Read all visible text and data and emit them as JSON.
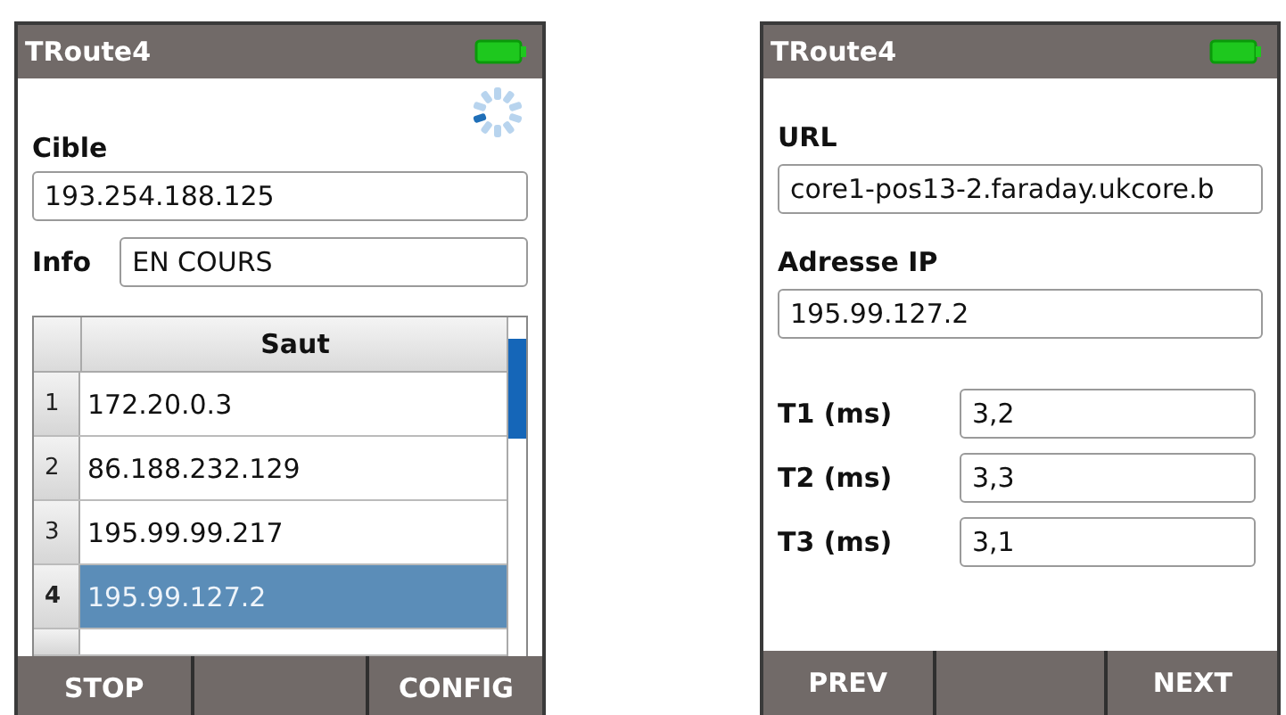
{
  "screens": [
    {
      "title": "TRoute4",
      "busy": true,
      "kind": "trace",
      "target": {
        "label": "Cible",
        "value": "193.254.188.125"
      },
      "info": {
        "label": "Info",
        "value": "EN COURS"
      },
      "table": {
        "columns": [
          "Saut"
        ],
        "rows": [
          {
            "index": "1",
            "hop": "172.20.0.3",
            "selected": false
          },
          {
            "index": "2",
            "hop": "86.188.232.129",
            "selected": false
          },
          {
            "index": "3",
            "hop": "195.99.99.217",
            "selected": false
          },
          {
            "index": "4",
            "hop": "195.99.127.2",
            "selected": true
          }
        ]
      },
      "softkeys": [
        {
          "kind": "label",
          "label": "STOP"
        },
        {
          "kind": "empty"
        },
        {
          "kind": "label",
          "label": "CONFIG"
        }
      ]
    },
    {
      "title": "TRoute4",
      "busy": false,
      "kind": "detail",
      "url": {
        "label": "URL",
        "value": "core1-pos13-2.faraday.ukcore.b"
      },
      "ip": {
        "label": "Adresse IP",
        "value": "195.99.127.2"
      },
      "times": [
        {
          "label": "T1 (ms)",
          "value": "3,2"
        },
        {
          "label": "T2 (ms)",
          "value": "3,3"
        },
        {
          "label": "T3 (ms)",
          "value": "3,1"
        }
      ],
      "softkeys": [
        {
          "kind": "label",
          "label": "PREV"
        },
        {
          "kind": "empty"
        },
        {
          "kind": "label",
          "label": "NEXT"
        }
      ]
    }
  ]
}
